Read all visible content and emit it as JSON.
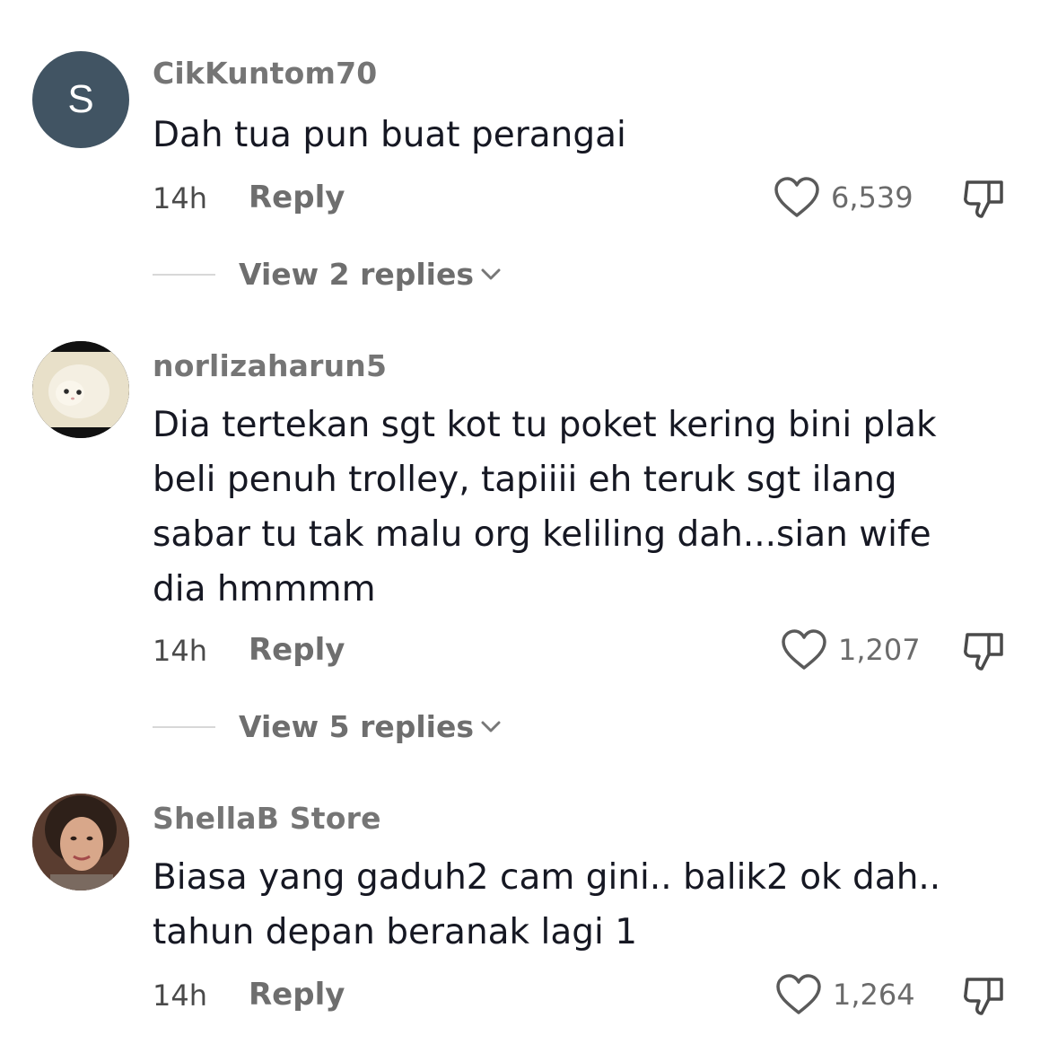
{
  "comments": [
    {
      "avatar_letter": "S",
      "username": "CikKuntom70",
      "text": "Dah tua pun buat perangai",
      "time": "14h",
      "reply_label": "Reply",
      "likes": "6,539",
      "view_replies": "View 2 replies"
    },
    {
      "username": "norlizaharun5",
      "text": "Dia tertekan sgt kot tu poket kering bini plak\nbeli penuh trolley, tapiiii eh teruk sgt ilang\nsabar tu tak malu org keliling dah...sian wife\ndia hmmmm",
      "time": "14h",
      "reply_label": "Reply",
      "likes": "1,207",
      "view_replies": "View 5 replies"
    },
    {
      "username": "ShellaB Store",
      "text": "Biasa yang gaduh2 cam gini.. balik2 ok dah..\ntahun depan beranak lagi 1",
      "time": "14h",
      "reply_label": "Reply",
      "likes": "1,264"
    }
  ]
}
